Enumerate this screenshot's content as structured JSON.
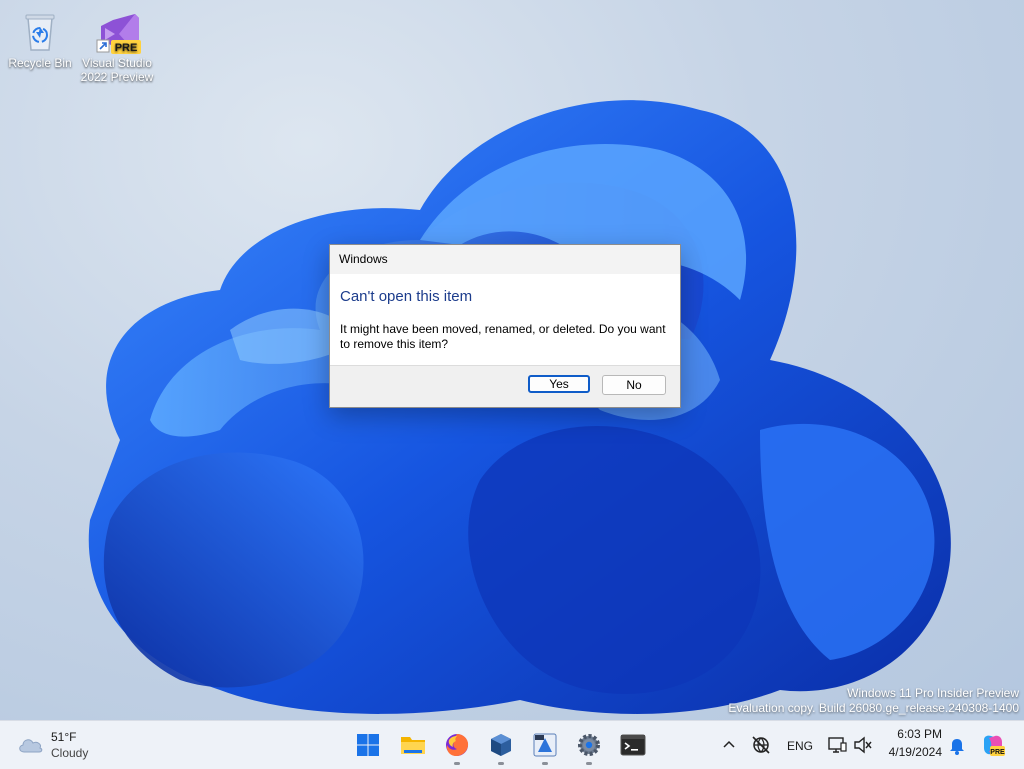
{
  "desktop": {
    "icons": [
      {
        "label": "Recycle Bin",
        "icon": "recycle-bin-icon"
      },
      {
        "label": "Visual Studio 2022 Preview",
        "icon": "visual-studio-preview-icon",
        "badge": "PRE"
      }
    ],
    "watermark": {
      "line1": "Windows 11 Pro Insider Preview",
      "line2": "Evaluation copy. Build 26080.ge_release.240308-1400"
    }
  },
  "dialog": {
    "title": "Windows",
    "heading": "Can't open this item",
    "message": "It might have been moved, renamed, or deleted. Do you want to remove this item?",
    "yes_label": "Yes",
    "no_label": "No",
    "colors": {
      "heading": "#1c3c8c",
      "default_border": "#0f5cc8"
    }
  },
  "taskbar": {
    "weather": {
      "temp": "51°F",
      "condition": "Cloudy",
      "icon": "cloud-icon"
    },
    "apps": [
      {
        "name": "start",
        "icon": "windows-start-icon"
      },
      {
        "name": "file-explorer",
        "icon": "folder-icon"
      },
      {
        "name": "firefox",
        "icon": "firefox-icon"
      },
      {
        "name": "virtualbox",
        "icon": "virtualbox-icon"
      },
      {
        "name": "app",
        "icon": "app-icon"
      },
      {
        "name": "settings",
        "icon": "gear-icon"
      },
      {
        "name": "terminal",
        "icon": "terminal-icon"
      }
    ],
    "tray": {
      "language": "ENG",
      "time": "6:03 PM",
      "date": "4/19/2024",
      "icons": [
        "chevron-up-icon",
        "network-off-icon",
        "display-icon",
        "volume-mute-icon",
        "bell-icon",
        "copilot-icon"
      ]
    }
  }
}
